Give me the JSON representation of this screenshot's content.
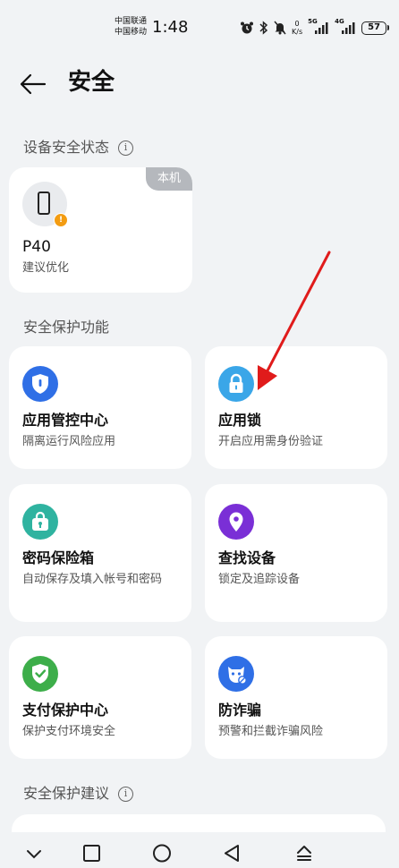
{
  "status_bar": {
    "carrier_1": "中国联通",
    "carrier_2": "中国移动",
    "time": "1:48",
    "net_speed_value": "0",
    "net_speed_unit": "K/s",
    "signal_1_label": "5G",
    "signal_2_label": "4G",
    "battery": "57"
  },
  "header": {
    "title": "安全"
  },
  "device_section": {
    "title": "设备安全状态",
    "device": {
      "badge": "本机",
      "name": "P40",
      "status": "建议优化",
      "warning_mark": "!"
    }
  },
  "protection_section": {
    "title": "安全保护功能",
    "features": [
      {
        "title": "应用管控中心",
        "subtitle": "隔离运行风险应用",
        "icon": "shield-icon",
        "color": "#2f6fe6"
      },
      {
        "title": "应用锁",
        "subtitle": "开启应用需身份验证",
        "icon": "lock-icon",
        "color": "#3aa6e8"
      },
      {
        "title": "密码保险箱",
        "subtitle": "自动保存及填入帐号和密码",
        "icon": "password-safe-icon",
        "color": "#2fb3a0"
      },
      {
        "title": "查找设备",
        "subtitle": "锁定及追踪设备",
        "icon": "location-pin-icon",
        "color": "#7a2fd6"
      },
      {
        "title": "支付保护中心",
        "subtitle": "保护支付环境安全",
        "icon": "shield-check-icon",
        "color": "#3dae4a"
      },
      {
        "title": "防诈骗",
        "subtitle": "预警和拦截诈骗风险",
        "icon": "anti-fraud-icon",
        "color": "#2f6fe6"
      }
    ]
  },
  "suggestion_section": {
    "title": "安全保护建议"
  },
  "annotation": {
    "color": "#e01b1b"
  }
}
